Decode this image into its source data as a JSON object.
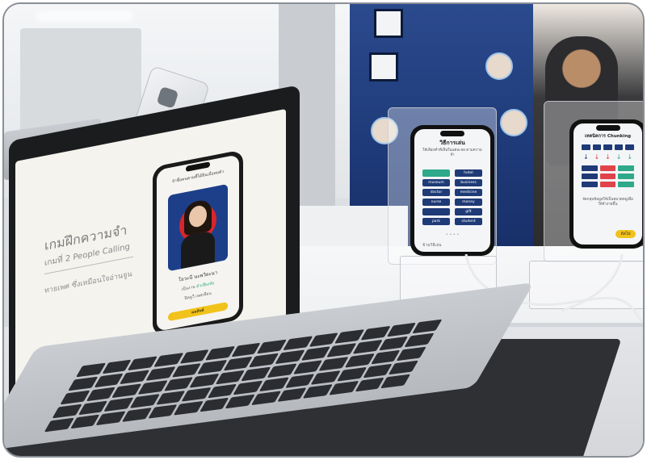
{
  "laptop_screen": {
    "title": "เกมฝึกความจำ",
    "subtitle": "เกมที่ 2 People Calling",
    "description": "ทายเพศ ซึ่งเหมือนใจอ่านจูน",
    "phone_header": "จำชื่อคนตามที่ได้ยินเมื่อพบตัว",
    "person_name": "โยวะนี นะพวิยะนา",
    "line_1": "เป็นงาน",
    "line_1_highlight": "ตัวเสียงฟัง",
    "line_2": "ฟิลลูวี เพศเพียน",
    "button": "ผลลัพธ์"
  },
  "phone_center": {
    "title": "วิธีการเล่น",
    "instructions": "ให้เลือกคำที่เห็นในแต่ละจอ ตามความจำ",
    "words": [
      {
        "label": "",
        "active": true
      },
      {
        "label": "hotel",
        "active": false
      },
      {
        "label": "museum",
        "active": false
      },
      {
        "label": "business",
        "active": false
      },
      {
        "label": "doctor",
        "active": false
      },
      {
        "label": "medicine",
        "active": false
      },
      {
        "label": "nurse",
        "active": false
      },
      {
        "label": "money",
        "active": false
      },
      {
        "label": "",
        "active": false
      },
      {
        "label": "gift",
        "active": false
      },
      {
        "label": "park",
        "active": false
      },
      {
        "label": "student",
        "active": false
      }
    ],
    "skip": "ข้ามวิธีเล่น",
    "pager": "• • • •"
  },
  "phone_right": {
    "title": "เทคนิคการ Chunking",
    "instructions": "จัดกลุ่มข้อมูลให้เป็นหมวดหมู่เพื่อให้จำง่ายขึ้น",
    "button": "ถัดไป"
  },
  "colors": {
    "navy": "#1f3b77",
    "green": "#2ea98a",
    "red": "#e0434a",
    "yellow": "#f1c21b"
  }
}
